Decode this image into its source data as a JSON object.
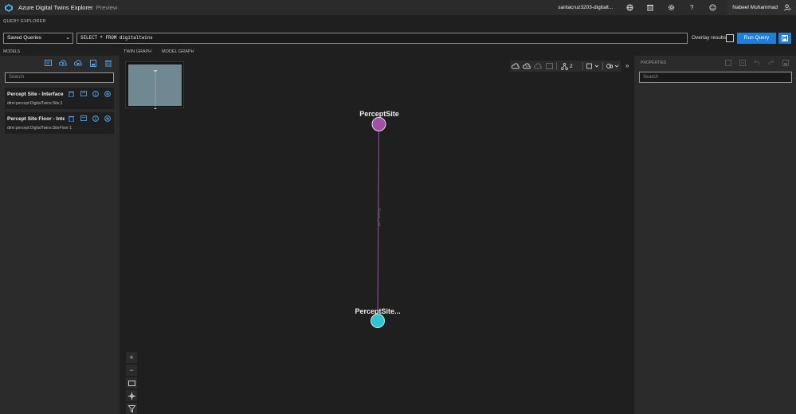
{
  "header": {
    "title": "Azure Digital Twins Explorer",
    "preview": "Preview",
    "environment": "santacruz3203-digitalt...",
    "user": "Nabeel Muhammad",
    "icons": [
      "globe-icon",
      "delete-icon",
      "settings-icon",
      "help-icon",
      "feedback-icon",
      "account-icon"
    ],
    "help_glyph": "?"
  },
  "query": {
    "section_label": "QUERY EXPLORER",
    "saved_queries": "Saved Queries",
    "text": "SELECT * FROM digitaltwins",
    "overlay_label": "Overlay results",
    "run_label": "Run Query"
  },
  "models": {
    "label": "MODELS",
    "search_placeholder": "Search",
    "items": [
      {
        "name": "Percept Site - Interface ...",
        "id": "dtmi:percept:DigitalTwins:Site;1"
      },
      {
        "name": "Percept Site Floor - Inte...",
        "id": "dtmi:percept:DigitalTwins:SiteFloor;1"
      }
    ]
  },
  "tabs": {
    "twin_graph": "TWIN GRAPH",
    "model_graph": "MODEL GRAPH"
  },
  "graph": {
    "depth": "2",
    "nodes": [
      {
        "label": "PerceptSite",
        "color": "#a44fa7"
      },
      {
        "label": "PerceptSite...",
        "color": "#2bc6d6"
      }
    ],
    "edge_color": "#a44fa7",
    "edge_label": "floors_rel"
  },
  "properties": {
    "label": "PROPERTIES",
    "search_placeholder": "Search"
  }
}
